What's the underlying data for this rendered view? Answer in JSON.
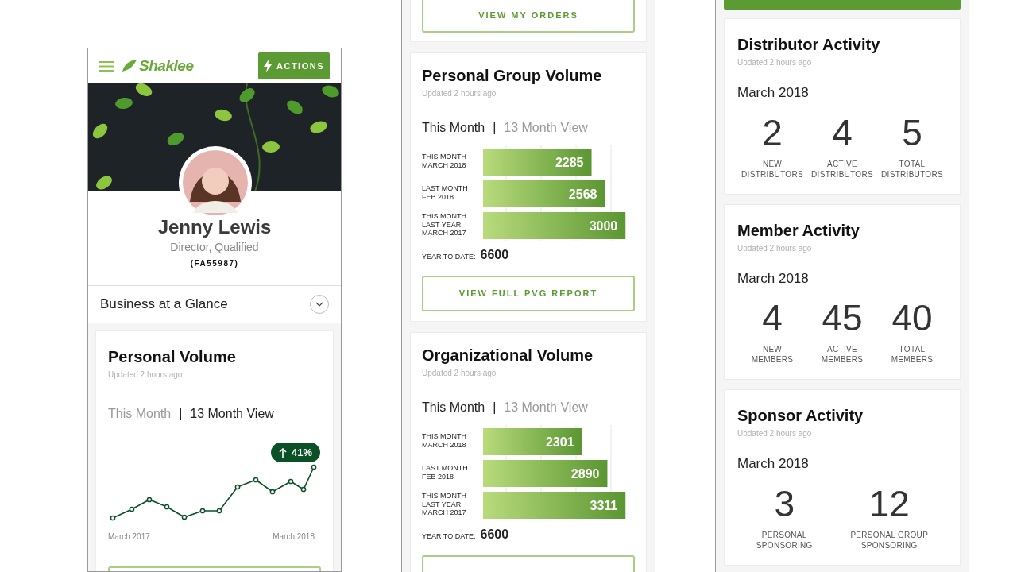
{
  "profile_screen": {
    "logo": "Shaklee",
    "actions_label": "ACTIONS",
    "profile": {
      "name": "Jenny Lewis",
      "title": "Director, Qualified",
      "id": "(FA55987)"
    },
    "section_label": "Business at a Glance",
    "card": {
      "title": "Personal Volume",
      "updated": "Updated 2 hours ago",
      "tabs": [
        {
          "label": "This Month",
          "selected": false
        },
        {
          "label": "13 Month View",
          "selected": true
        }
      ],
      "separator": "|",
      "badge": "41%",
      "x_labels": [
        "March 2017",
        "March 2018"
      ]
    }
  },
  "volume_screen": {
    "orders_button": "VIEW MY ORDERS",
    "cards": [
      {
        "title": "Personal Group Volume",
        "updated": "Updated 2 hours ago",
        "tabs": [
          {
            "label": "This Month",
            "selected": true
          },
          {
            "label": "13 Month View",
            "selected": false
          }
        ],
        "separator": "|",
        "chart_data": {
          "type": "bar",
          "categories": [
            "THIS MONTH\nMARCH 2018",
            "LAST MONTH\nFEB 2018",
            "THIS MONTH\nLAST YEAR\nMARCH 2017"
          ],
          "values": [
            2285,
            2568,
            3000
          ],
          "orientation": "horizontal",
          "data_labels": true
        },
        "ytd_label": "YEAR TO DATE:",
        "ytd_value": "6600",
        "button": "VIEW FULL PVG REPORT"
      },
      {
        "title": "Organizational Volume",
        "updated": "Updated 2 hours ago",
        "tabs": [
          {
            "label": "This Month",
            "selected": true
          },
          {
            "label": "13 Month View",
            "selected": false
          }
        ],
        "separator": "|",
        "chart_data": {
          "type": "bar",
          "categories": [
            "THIS MONTH\nMARCH 2018",
            "LAST MONTH\nFEB 2018",
            "THIS MONTH\nLAST YEAR\nMARCH 2017"
          ],
          "values": [
            2301,
            2890,
            3311
          ],
          "orientation": "horizontal",
          "data_labels": true
        },
        "ytd_label": "YEAR TO DATE:",
        "ytd_value": "6600"
      }
    ]
  },
  "activity_screen": {
    "cards": [
      {
        "title": "Distributor Activity",
        "updated": "Updated 2 hours ago",
        "period": "March 2018",
        "stats": [
          {
            "value": "2",
            "label": "NEW\nDISTRIBUTORS"
          },
          {
            "value": "4",
            "label": "ACTIVE\nDISTRIBUTORS"
          },
          {
            "value": "5",
            "label": "TOTAL\nDISTRIBUTORS"
          }
        ]
      },
      {
        "title": "Member Activity",
        "updated": "Updated 2 hours ago",
        "period": "March 2018",
        "stats": [
          {
            "value": "4",
            "label": "NEW\nMEMBERS"
          },
          {
            "value": "45",
            "label": "ACTIVE\nMEMBERS"
          },
          {
            "value": "40",
            "label": "TOTAL\nMEMBERS"
          }
        ]
      },
      {
        "title": "Sponsor Activity",
        "updated": "Updated 2 hours ago",
        "period": "March 2018",
        "stats": [
          {
            "value": "3",
            "label": "PERSONAL\nSPONSORING"
          },
          {
            "value": "12",
            "label": "PERSONAL GROUP\nSPONSORING"
          }
        ]
      }
    ]
  }
}
